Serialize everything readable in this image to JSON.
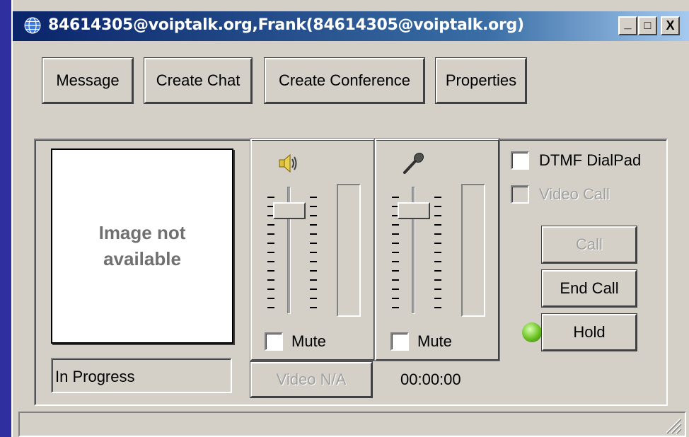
{
  "window": {
    "title": "84614305@voiptalk.org,Frank(84614305@voiptalk.org)",
    "controls": {
      "minimize": "_",
      "maximize": "□",
      "close": "X"
    }
  },
  "toolbar": {
    "message": "Message",
    "create_chat": "Create Chat",
    "create_conference": "Create Conference",
    "properties": "Properties"
  },
  "video": {
    "placeholder_line1": "Image not",
    "placeholder_line2": "available",
    "status": "In Progress",
    "video_button": "Video N/A"
  },
  "speaker": {
    "mute_label": "Mute",
    "mute_checked": false,
    "volume_level": 0.85
  },
  "microphone": {
    "mute_label": "Mute",
    "mute_checked": false,
    "volume_level": 0.85
  },
  "call": {
    "dtmf_label": "DTMF DialPad",
    "video_call_label": "Video Call",
    "call_button": "Call",
    "end_call_button": "End Call",
    "hold_button": "Hold",
    "timer": "00:00:00",
    "led_color": "#6ac020"
  }
}
